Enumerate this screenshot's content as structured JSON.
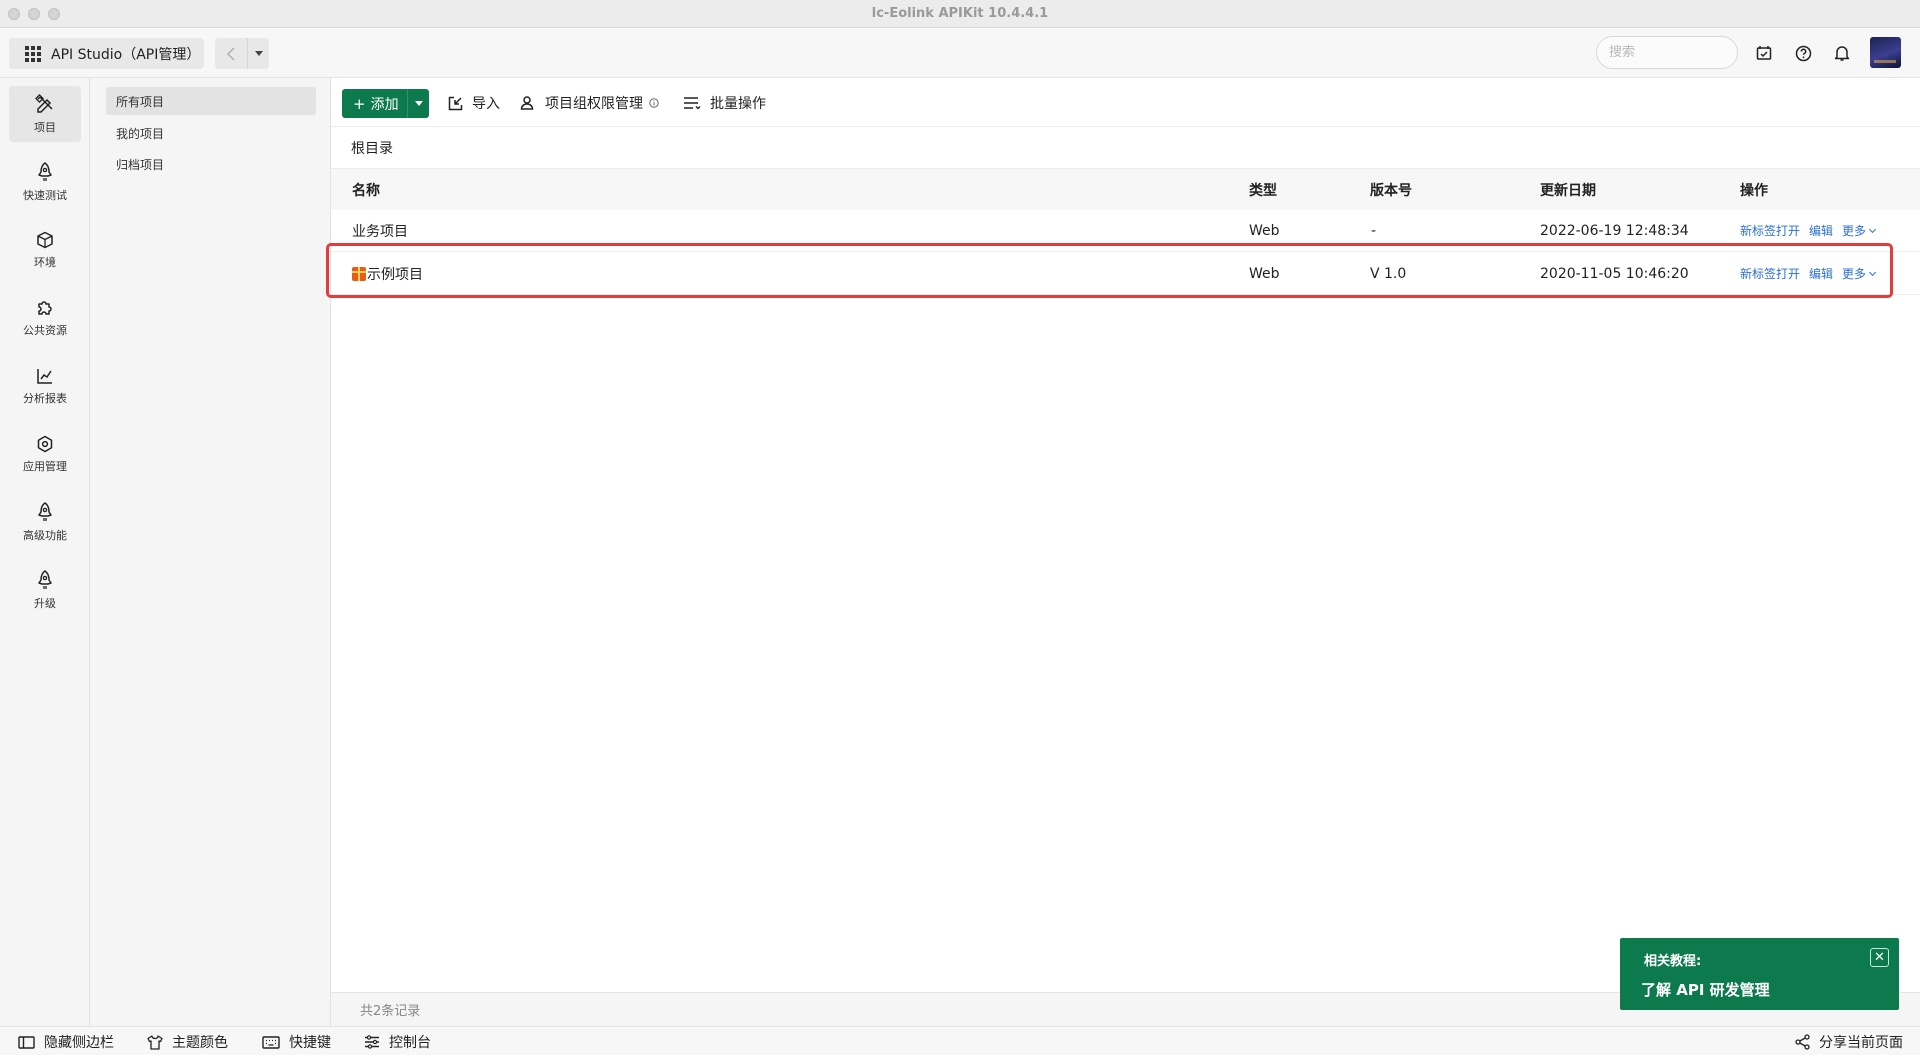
{
  "window": {
    "title": "lc-Eolink APIKit 10.4.4.1"
  },
  "topbar": {
    "studio_label": "API Studio（API管理）",
    "search_placeholder": "搜索"
  },
  "left_rail": [
    {
      "label": "项目",
      "icon": "pencil-ruler-icon",
      "active": true
    },
    {
      "label": "快速测试",
      "icon": "rocket-icon"
    },
    {
      "label": "环境",
      "icon": "cube-icon"
    },
    {
      "label": "公共资源",
      "icon": "puzzle-icon"
    },
    {
      "label": "分析报表",
      "icon": "chart-icon"
    },
    {
      "label": "应用管理",
      "icon": "gear-icon"
    },
    {
      "label": "高级功能",
      "icon": "rocket-icon"
    },
    {
      "label": "升级",
      "icon": "rocket-icon"
    }
  ],
  "subnav": [
    {
      "label": "所有项目",
      "active": true
    },
    {
      "label": "我的项目"
    },
    {
      "label": "归档项目"
    }
  ],
  "toolbar": {
    "add_label": "添加",
    "import_label": "导入",
    "permission_label": "项目组权限管理",
    "batch_label": "批量操作"
  },
  "breadcrumb": "根目录",
  "table": {
    "columns": [
      "名称",
      "类型",
      "版本号",
      "更新日期",
      "操作"
    ],
    "rows": [
      {
        "name": "业务项目",
        "type": "Web",
        "version": "-",
        "updated": "2022-06-19 12:48:34",
        "has_gift_icon": false
      },
      {
        "name": "示例项目",
        "type": "Web",
        "version": "V 1.0",
        "updated": "2020-11-05 10:46:20",
        "has_gift_icon": true
      }
    ],
    "actions": {
      "open_new_tab": "新标签打开",
      "edit": "编辑",
      "more": "更多"
    }
  },
  "record_count": "共2条记录",
  "tutorial": {
    "label": "相关教程:",
    "link": "了解 API 研发管理"
  },
  "bottombar": {
    "hide_sidebar": "隐藏侧边栏",
    "theme_color": "主题颜色",
    "shortcuts": "快捷键",
    "console": "控制台",
    "share_page": "分享当前页面"
  },
  "colors": {
    "accent": "#0d7a4d",
    "link": "#2b6fd6",
    "highlight_border": "#e23c3c"
  }
}
